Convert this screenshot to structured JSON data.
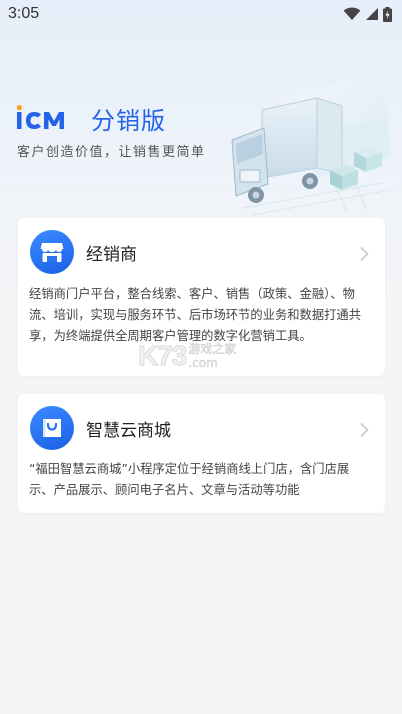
{
  "status_bar": {
    "time": "3:05",
    "icons": [
      "wifi-icon",
      "signal-icon",
      "battery-charging-icon"
    ]
  },
  "header": {
    "logo": "iCM",
    "app_name": "分销版",
    "slogan": "客户创造价值，让销售更简单"
  },
  "cards": [
    {
      "title": "经销商",
      "icon": "store-icon",
      "description": "经销商门户平台，整合线索、客户、销售（政策、金融）、物流、培训，实现与服务环节、后市场环节的业务和数据打通共享，为终端提供全周期客户管理的数字化营销工具。"
    },
    {
      "title": "智慧云商城",
      "icon": "shopping-bag-icon",
      "description": "“福田智慧云商城”小程序定位于经销商线上门店，含门店展示、产品展示、顾问电子名片、文章与活动等功能"
    }
  ],
  "watermark": {
    "main": "K73",
    "line1": "游戏之家",
    "line2": ".com"
  },
  "colors": {
    "brand_blue": "#2564e8",
    "background": "#f4f5f7",
    "card": "#ffffff"
  }
}
